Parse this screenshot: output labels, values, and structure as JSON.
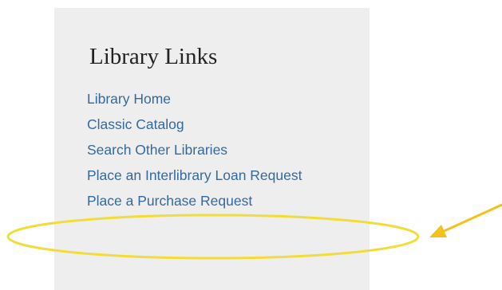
{
  "sidebar": {
    "title": "Library Links",
    "links": [
      {
        "label": "Library Home"
      },
      {
        "label": "Classic Catalog"
      },
      {
        "label": "Search Other Libraries"
      },
      {
        "label": "Place an Interlibrary Loan Request"
      },
      {
        "label": "Place a Purchase Request"
      }
    ]
  },
  "annotation": {
    "highlight_color": "#f2dc3a",
    "arrow_color": "#f2c21b",
    "highlighted_item": "Place a Purchase Request"
  },
  "colors": {
    "panel_background": "#eeeeee",
    "link": "#33699e",
    "title": "#222222"
  }
}
